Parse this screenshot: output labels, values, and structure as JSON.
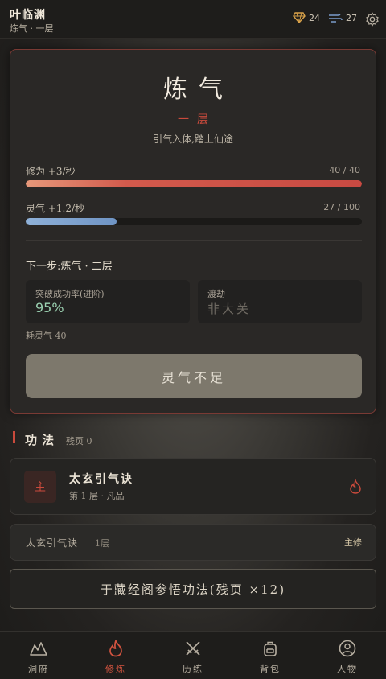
{
  "header": {
    "player_name": "叶临渊",
    "realm_line": "炼气 · 一层",
    "gems": "24",
    "spirit_stones": "27",
    "settings_icon": "gear-icon"
  },
  "cultivation": {
    "realm": "炼气",
    "layer": "一层",
    "description": "引气入体,踏上仙途",
    "cultivation_label": "修为 +3/秒",
    "cultivation_value": "40 / 40",
    "cultivation_progress": 1.0,
    "spirit_label": "灵气 +1.2/秒",
    "spirit_value": "27 / 100",
    "spirit_progress": 0.27,
    "next_step": "下一步:炼气 · 二层",
    "breakthrough_title": "突破成功率(进阶)",
    "breakthrough_rate": "95%",
    "tribulation_title": "渡劫",
    "tribulation_value": "非大关",
    "cost": "耗灵气 40",
    "action_button": "灵气不足"
  },
  "techniques": {
    "section_title": "功法",
    "fragments": "残页 0",
    "main_tech": {
      "badge": "主",
      "name": "太玄引气诀",
      "meta": "第 1 层 · 凡品"
    },
    "row": {
      "name": "太玄引气诀",
      "level": "1层",
      "tag": "主修"
    },
    "study_button": "于藏经阁参悟功法(残页 ×12)"
  },
  "nav": [
    {
      "label": "洞府",
      "icon": "mountain-icon"
    },
    {
      "label": "修炼",
      "icon": "flame-icon",
      "active": true
    },
    {
      "label": "历练",
      "icon": "crossed-swords-icon"
    },
    {
      "label": "背包",
      "icon": "backpack-icon"
    },
    {
      "label": "人物",
      "icon": "person-icon"
    }
  ],
  "colors": {
    "accent": "#c94a3c",
    "cultivation_bar": "#d25a4c",
    "spirit_bar": "#7a9ccb",
    "success": "#9bd1b1"
  }
}
